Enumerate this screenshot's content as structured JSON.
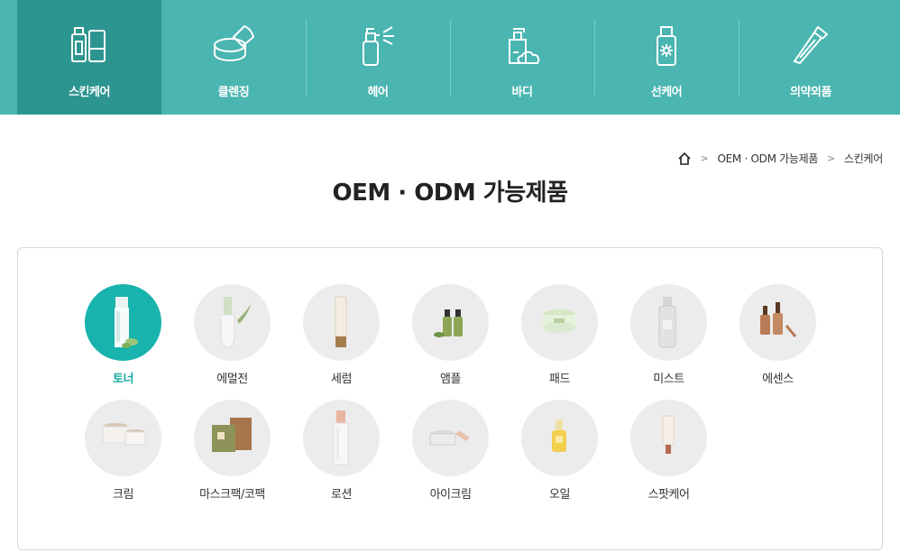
{
  "topnav": {
    "items": [
      {
        "label": "스킨케어",
        "icon": "skincare-bottles-icon",
        "active": true
      },
      {
        "label": "클렌징",
        "icon": "cleansing-jar-icon"
      },
      {
        "label": "헤어",
        "icon": "hair-spray-icon"
      },
      {
        "label": "바디",
        "icon": "body-pump-icon"
      },
      {
        "label": "선케어",
        "icon": "suncare-bottle-icon"
      },
      {
        "label": "의약외품",
        "icon": "tube-icon"
      }
    ]
  },
  "breadcrumb": {
    "home_icon": "home-icon",
    "items": [
      "OEM · ODM 가능제품",
      "스킨케어"
    ]
  },
  "page": {
    "title": "OEM · ODM 가능제품"
  },
  "products": [
    {
      "label": "토너",
      "active": true
    },
    {
      "label": "에멀전"
    },
    {
      "label": "세럼"
    },
    {
      "label": "앰플"
    },
    {
      "label": "패드"
    },
    {
      "label": "미스트"
    },
    {
      "label": "에센스"
    },
    {
      "label": "크림"
    },
    {
      "label": "마스크팩/코팩"
    },
    {
      "label": "로션"
    },
    {
      "label": "아이크림"
    },
    {
      "label": "오일"
    },
    {
      "label": "스팟케어"
    }
  ],
  "colors": {
    "nav_bg": "#4ab5b1",
    "nav_active": "#2d9590",
    "accent": "#17b3ac"
  }
}
